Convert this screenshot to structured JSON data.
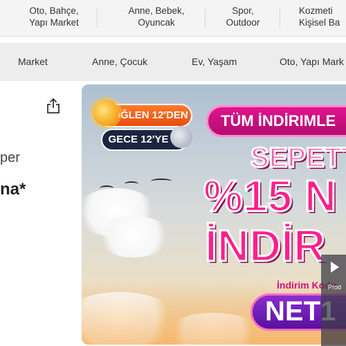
{
  "top_categories": [
    {
      "line1": "Oto, Bahçe,",
      "line2": "Yapı Market"
    },
    {
      "line1": "Anne, Bebek,",
      "line2": "Oyuncak"
    },
    {
      "line1": "Spor,",
      "line2": "Outdoor"
    },
    {
      "line1": "Kozmeti",
      "line2": "Kişisel Ba"
    }
  ],
  "nav_items": [
    "Market",
    "Anne, Çocuk",
    "Ev, Yaşam",
    "Oto, Yapı Mark"
  ],
  "product": {
    "text_line1": "per",
    "text_line2": "na*"
  },
  "banner": {
    "noon_label": "ÖĞLEN 12'DEN",
    "night_label": "GECE 12'YE",
    "headline": "TÜM İNDİRIMLE",
    "line_basket": "SEPETT",
    "line_percent": "%15 N",
    "line_discount": "İNDİR",
    "code_label": "İndirim Kodu",
    "code": "NET1"
  },
  "side": {
    "caption": "Prod"
  },
  "colors": {
    "accent_pink": "#e0148e",
    "code_purple": "#6a1cb4",
    "noon_orange": "#f25f1a",
    "night_navy": "#1c2540"
  },
  "icons": {
    "share": "share-icon",
    "play": "play-icon"
  }
}
